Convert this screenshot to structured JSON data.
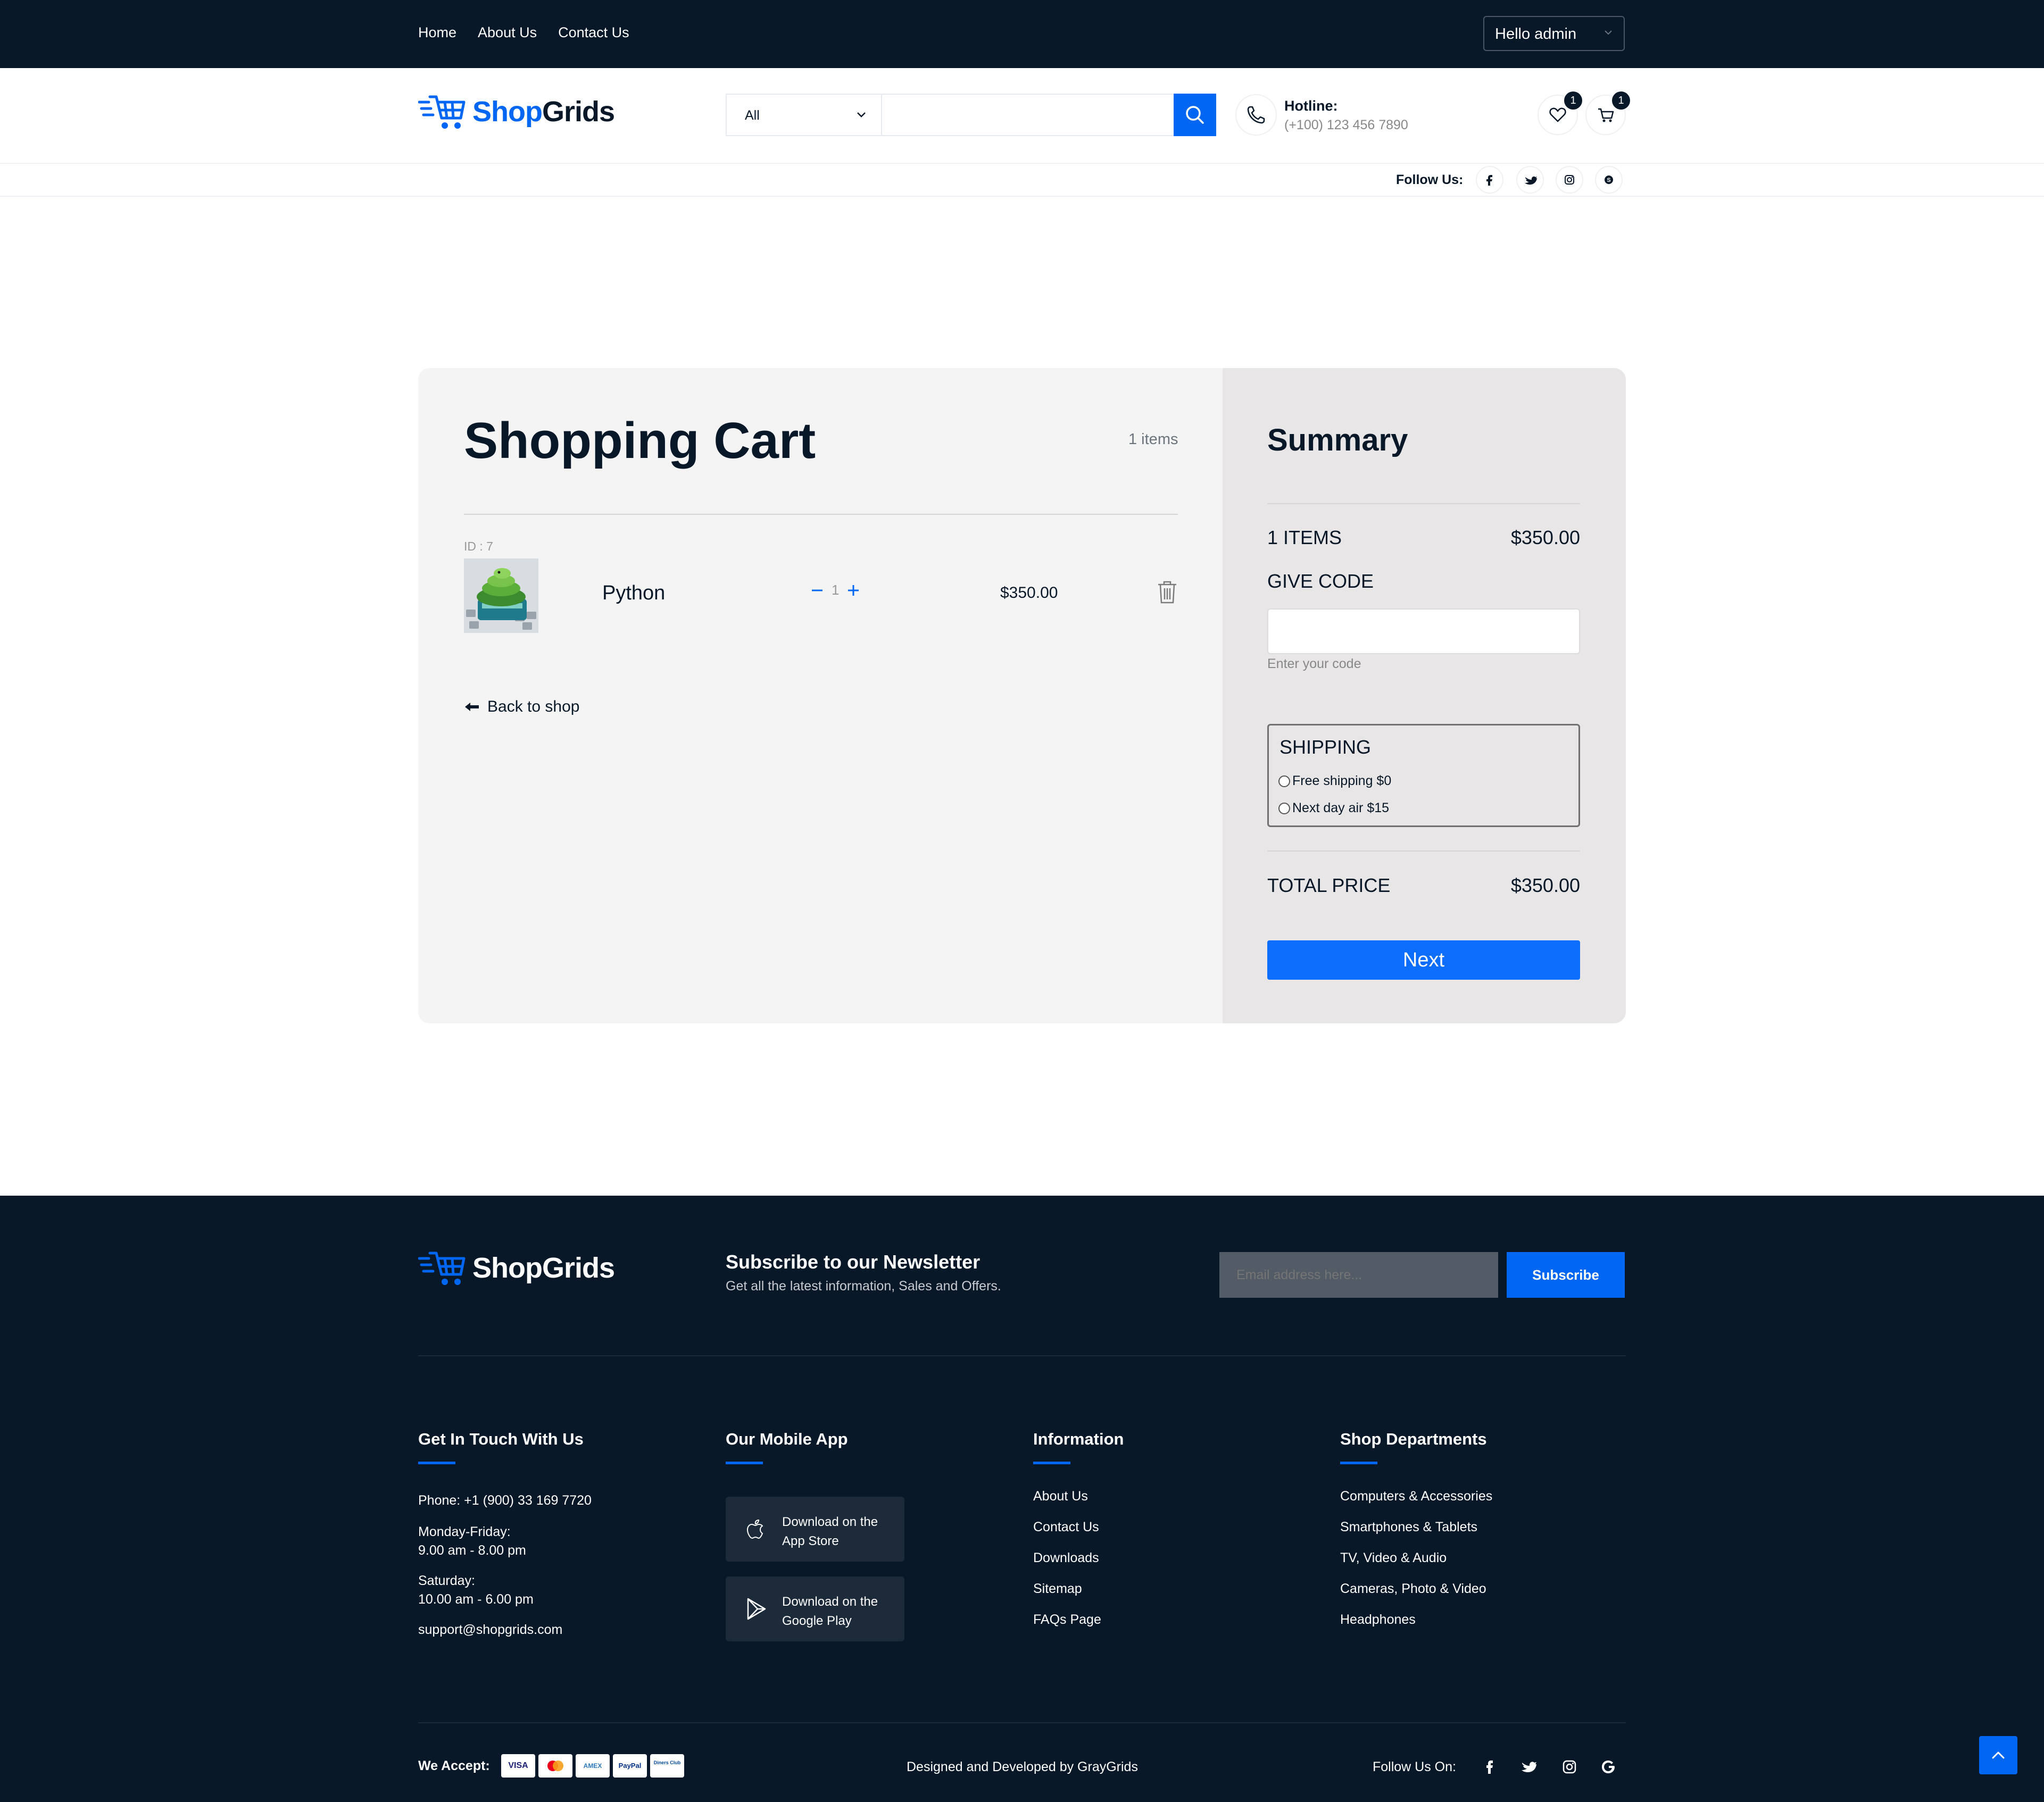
{
  "topbar": {
    "nav": [
      "Home",
      "About Us",
      "Contact Us"
    ],
    "account": "Hello admin"
  },
  "header": {
    "logo": {
      "shop": "Shop",
      "grids": "Grids"
    },
    "search": {
      "category": "All",
      "placeholder": ""
    },
    "hotline": {
      "title": "Hotline:",
      "number": "(+100) 123 456 7890"
    },
    "wishlist_count": "1",
    "cart_count": "1",
    "follow_label": "Follow Us:"
  },
  "cart": {
    "title": "Shopping Cart",
    "count": "1 items",
    "items": [
      {
        "id": "ID : 7",
        "name": "Python",
        "quantity": "1",
        "price": "$350.00"
      }
    ],
    "back_label": "Back to shop"
  },
  "summary": {
    "title": "Summary",
    "items_label": "1 ITEMS",
    "items_total": "$350.00",
    "code_label": "GIVE CODE",
    "code_value": "",
    "code_hint": "Enter your code",
    "shipping_label": "SHIPPING",
    "shipping_options": [
      "Free shipping $0",
      "Next day air $15"
    ],
    "total_label": "TOTAL PRICE",
    "total_value": "$350.00",
    "next_label": "Next"
  },
  "footer": {
    "logo": "ShopGrids",
    "newsletter": {
      "title": "Subscribe to our Newsletter",
      "subtitle": "Get all the latest information, Sales and Offers.",
      "placeholder": "Email address here...",
      "button": "Subscribe"
    },
    "contact": {
      "heading": "Get In Touch With Us",
      "phone": "Phone: +1 (900) 33 169 7720",
      "weekday_label": "Monday-Friday:",
      "weekday_hours": "9.00 am - 8.00 pm",
      "saturday_label": "Saturday:",
      "saturday_hours": "10.00 am - 6.00 pm",
      "email": "support@shopgrids.com"
    },
    "app": {
      "heading": "Our Mobile App",
      "appstore_line1": "Download on the",
      "appstore_line2": "App Store",
      "play_line1": "Download on the",
      "play_line2": "Google Play"
    },
    "information": {
      "heading": "Information",
      "links": [
        "About Us",
        "Contact Us",
        "Downloads",
        "Sitemap",
        "FAQs Page"
      ]
    },
    "departments": {
      "heading": "Shop Departments",
      "links": [
        "Computers & Accessories",
        "Smartphones & Tablets",
        "TV, Video & Audio",
        "Cameras, Photo & Video",
        "Headphones"
      ]
    },
    "accept_label": "We Accept:",
    "cards": [
      "VISA",
      "mastercard",
      "AMEX",
      "PayPal",
      "Diners Club"
    ],
    "credit": "Designed and Developed by GrayGrids",
    "follow_label": "Follow Us On:"
  },
  "icons": {
    "accent": "#0167f3",
    "dark": "#081828",
    "names": [
      "cart-logo-icon",
      "search-icon",
      "phone-icon",
      "heart-icon",
      "cart-icon",
      "facebook-icon",
      "twitter-icon",
      "instagram-icon",
      "skype-icon",
      "minus-icon",
      "plus-icon",
      "trash-icon",
      "arrow-left-icon",
      "apple-icon",
      "play-icon",
      "google-icon",
      "chevron-up-icon"
    ]
  }
}
